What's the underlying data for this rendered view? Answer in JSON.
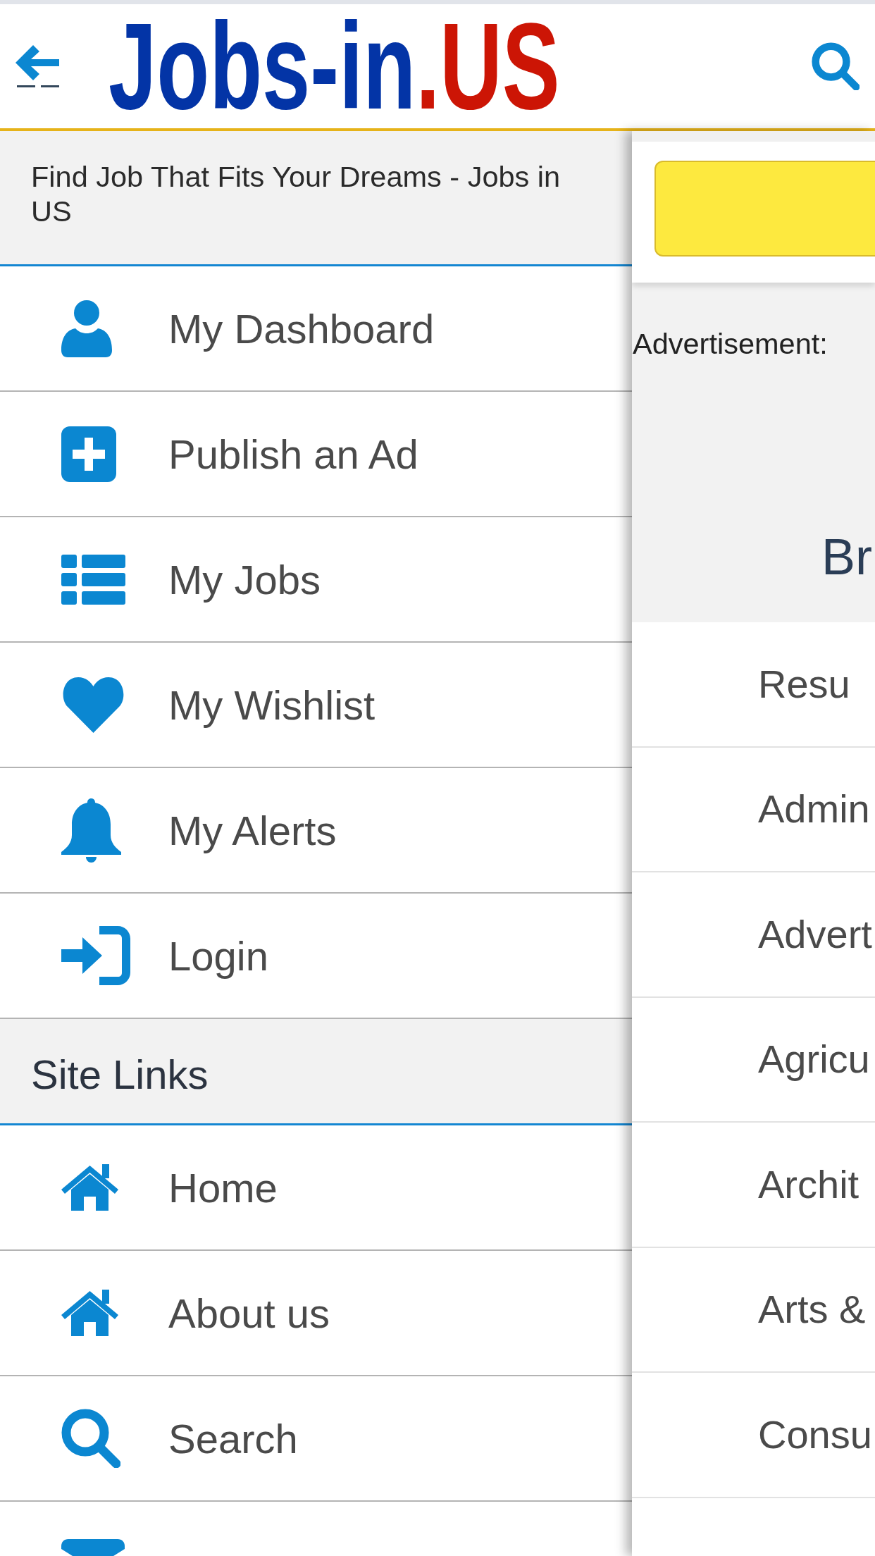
{
  "header": {
    "logo": {
      "main": "Jobs-in",
      "suffix": ".US"
    }
  },
  "drawer": {
    "tagline": "Find Job That Fits Your Dreams - Jobs in US",
    "account_items": [
      {
        "kind": "dashboard",
        "label": "My Dashboard"
      },
      {
        "kind": "publish",
        "label": "Publish an Ad"
      },
      {
        "kind": "jobs",
        "label": "My Jobs"
      },
      {
        "kind": "wishlist",
        "label": "My Wishlist"
      },
      {
        "kind": "alerts",
        "label": "My Alerts"
      },
      {
        "kind": "login",
        "label": "Login"
      }
    ],
    "site_links": {
      "title": "Site Links",
      "items": [
        {
          "kind": "home",
          "label": "Home"
        },
        {
          "kind": "about",
          "label": "About us"
        },
        {
          "kind": "search",
          "label": "Search"
        },
        {
          "kind": "contact"
        }
      ]
    }
  },
  "content": {
    "ad_label": "Advertisement:",
    "section_title": "Br",
    "categories": [
      "Resu",
      "Admin",
      "Advert",
      "Agricu",
      "Archit",
      "Arts &",
      "Consu"
    ]
  }
}
